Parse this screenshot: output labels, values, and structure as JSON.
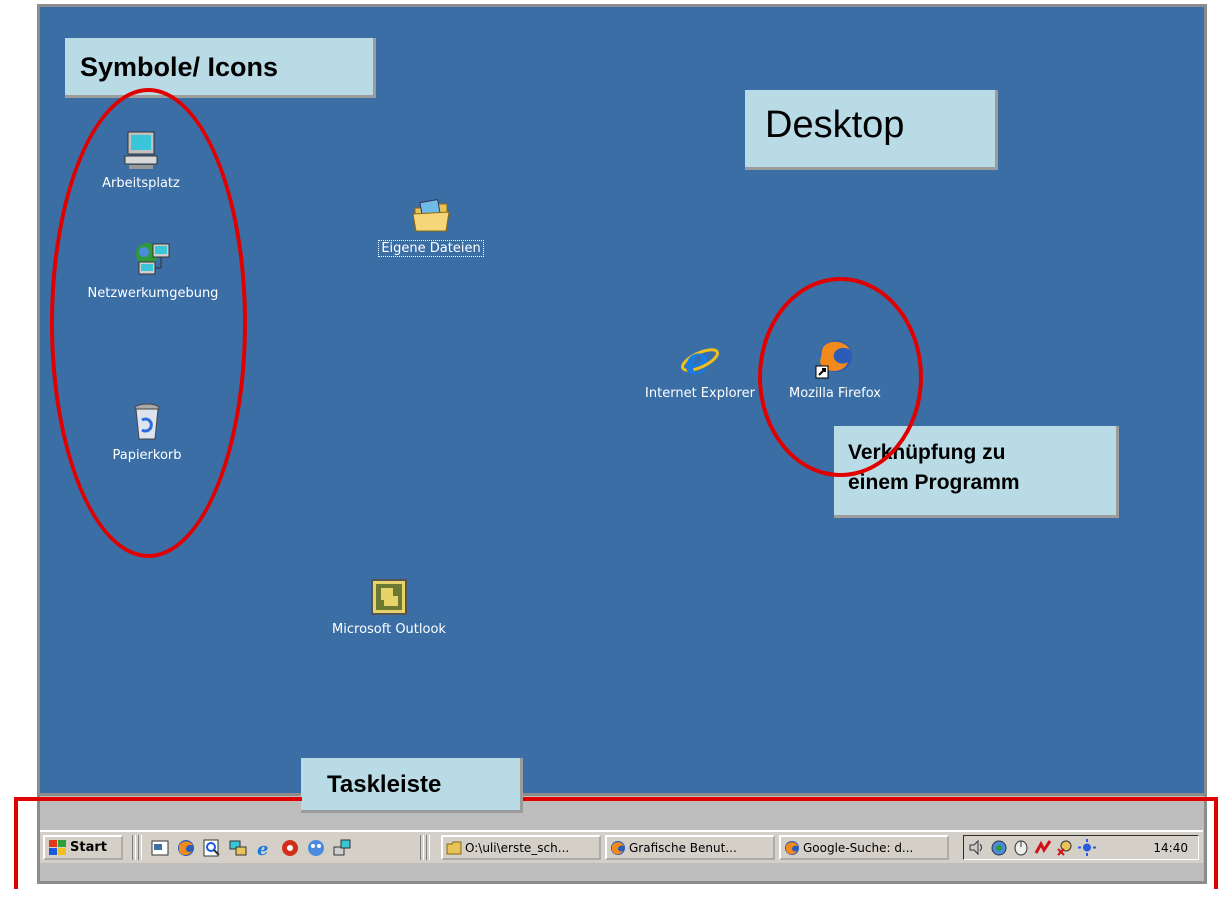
{
  "callouts": {
    "symbols": "Symbole/ Icons",
    "desktop": "Desktop",
    "shortcut_line1": "Verknüpfung zu",
    "shortcut_line2": "einem Programm",
    "taskbar": "Taskleiste"
  },
  "desktop_icons": {
    "arbeitsplatz": "Arbeitsplatz",
    "netzwerk": "Netzwerkumgebung",
    "papierkorb": "Papierkorb",
    "eigene_dateien": "Eigene Dateien",
    "internet_explorer": "Internet Explorer",
    "firefox": "Mozilla Firefox",
    "outlook": "Microsoft Outlook"
  },
  "taskbar": {
    "start_label": "Start",
    "tasks": [
      {
        "label": "O:\\uli\\erste_sch...",
        "icon": "folder-icon"
      },
      {
        "label": "Grafische Benut...",
        "icon": "firefox-icon"
      },
      {
        "label": "Google-Suche: d...",
        "icon": "firefox-icon"
      }
    ],
    "clock": "14:40"
  },
  "colors": {
    "desktop_bg": "#3a6ea5",
    "callout_bg": "#b9dbe6",
    "highlight_red": "#e00000",
    "taskbar_bg": "#d4d0c8"
  }
}
